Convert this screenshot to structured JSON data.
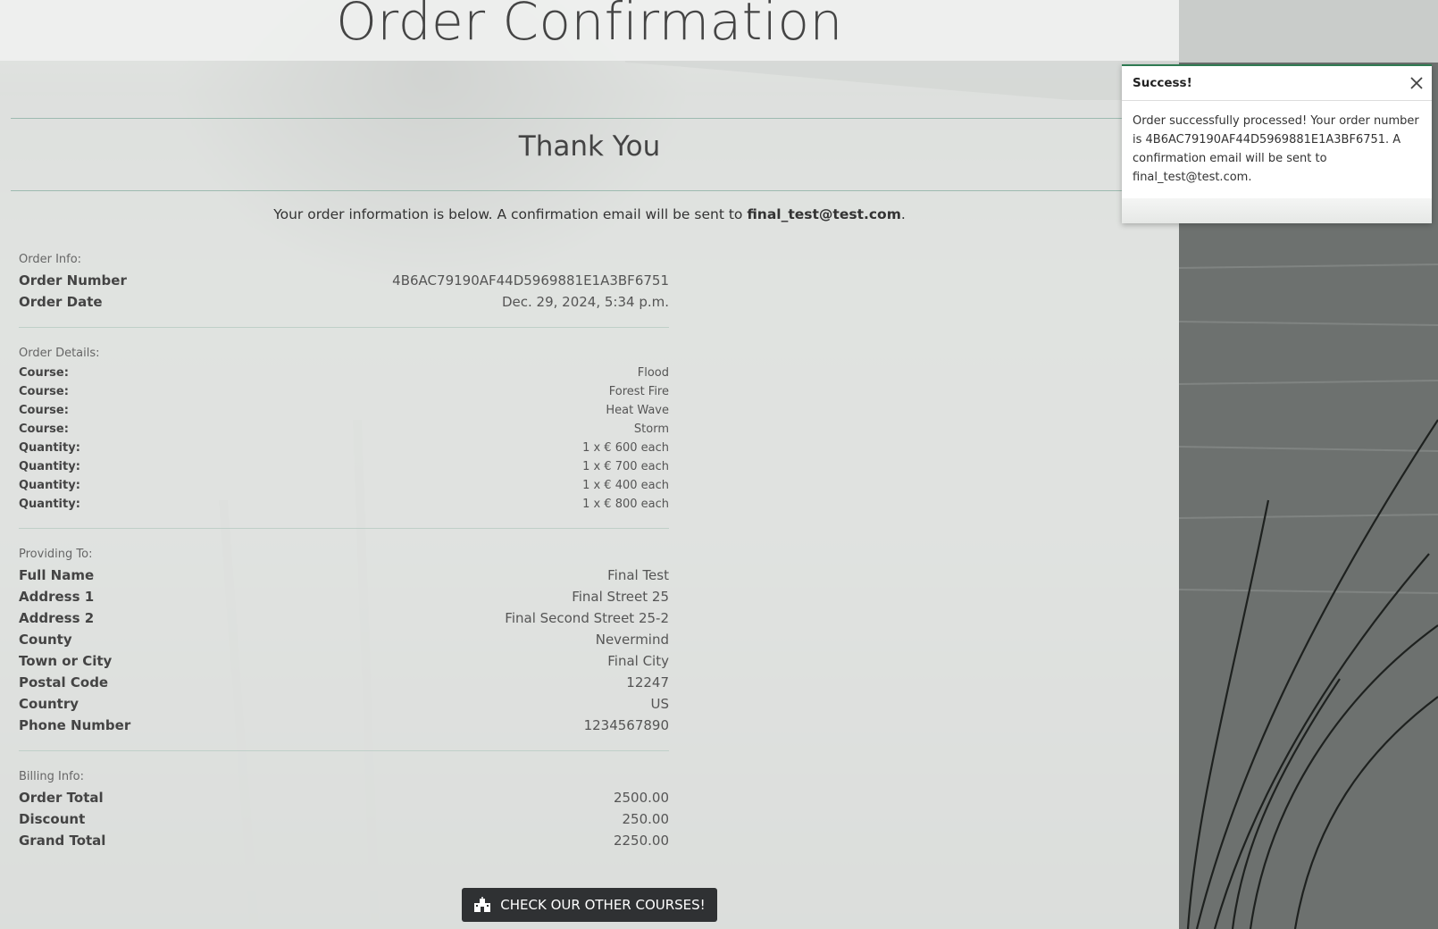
{
  "page": {
    "title": "Order Confirmation",
    "thank_you": "Thank You",
    "intro_prefix": "Your order information is below. A confirmation email will be sent to ",
    "intro_email": "final_test@test.com",
    "intro_suffix": "."
  },
  "order_info": {
    "label": "Order Info:",
    "rows": [
      {
        "key": "Order Number",
        "value": "4B6AC79190AF44D5969881E1A3BF6751"
      },
      {
        "key": "Order Date",
        "value": "Dec. 29, 2024, 5:34 p.m."
      }
    ]
  },
  "order_details": {
    "label": "Order Details:",
    "rows": [
      {
        "key": "Course:",
        "value": "Flood"
      },
      {
        "key": "Course:",
        "value": "Forest Fire"
      },
      {
        "key": "Course:",
        "value": "Heat Wave"
      },
      {
        "key": "Course:",
        "value": "Storm"
      },
      {
        "key": "Quantity:",
        "value": "1 x  € 600 each"
      },
      {
        "key": "Quantity:",
        "value": "1 x  € 700 each"
      },
      {
        "key": "Quantity:",
        "value": "1 x  € 400 each"
      },
      {
        "key": "Quantity:",
        "value": "1 x  € 800 each"
      }
    ]
  },
  "providing_to": {
    "label": "Providing To:",
    "rows": [
      {
        "key": "Full Name",
        "value": "Final Test"
      },
      {
        "key": "Address 1",
        "value": "Final Street 25"
      },
      {
        "key": "Address 2",
        "value": "Final Second Street 25-2"
      },
      {
        "key": "County",
        "value": "Nevermind"
      },
      {
        "key": "Town or City",
        "value": "Final City"
      },
      {
        "key": "Postal Code",
        "value": "12247"
      },
      {
        "key": "Country",
        "value": "US"
      },
      {
        "key": "Phone Number",
        "value": "1234567890"
      }
    ]
  },
  "billing_info": {
    "label": "Billing Info:",
    "rows": [
      {
        "key": "Order Total",
        "value": "2500.00"
      },
      {
        "key": "Discount",
        "value": "250.00"
      },
      {
        "key": "Grand Total",
        "value": "2250.00"
      }
    ]
  },
  "cta": {
    "label": "CHECK OUR OTHER COURSES!",
    "icon": "school-building-icon"
  },
  "toast": {
    "title": "Success!",
    "message": "Order successfully processed! Your order number is 4B6AC79190AF44D5969881E1A3BF6751. A confirmation email will be sent to final_test@test.com.",
    "close_icon": "close-icon",
    "accent": "#2f7a52"
  },
  "colors": {
    "button_bg": "#2f3133",
    "divider": "#9dbbb0"
  }
}
